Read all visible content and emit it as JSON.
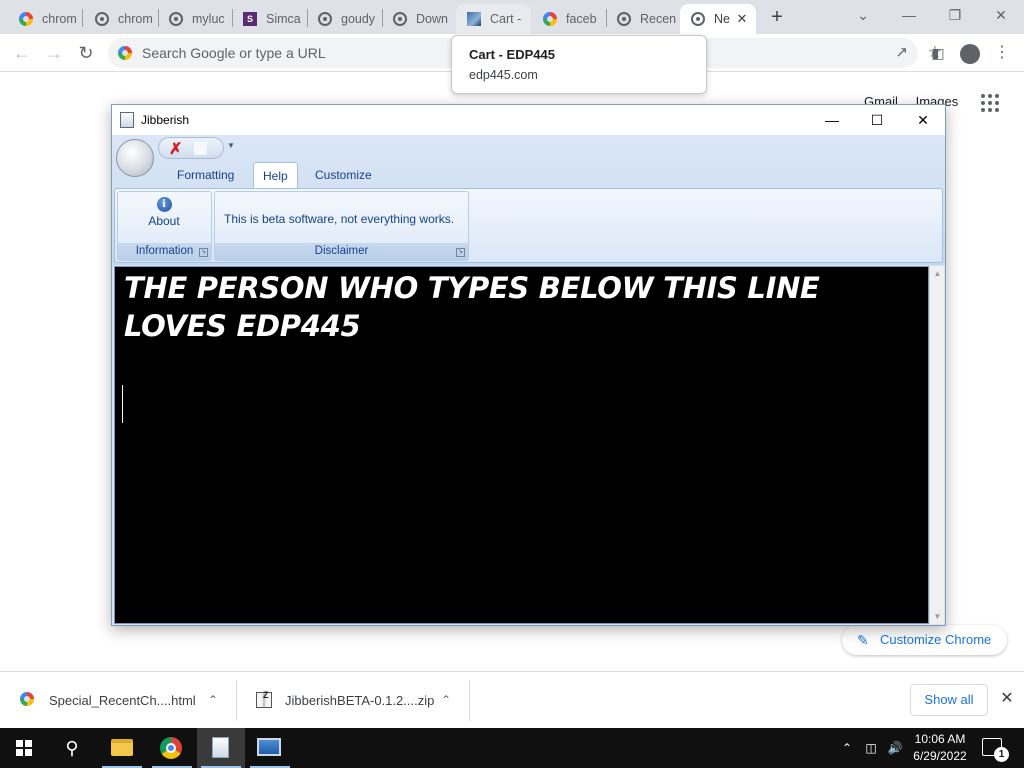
{
  "browser": {
    "tabs": [
      {
        "label": "chrom",
        "icon": "google-icon"
      },
      {
        "label": "chrom",
        "icon": "globe-icon"
      },
      {
        "label": "myluc",
        "icon": "globe-icon"
      },
      {
        "label": "Simca",
        "icon": "simca-icon"
      },
      {
        "label": "goudy",
        "icon": "globe-icon"
      },
      {
        "label": "Down",
        "icon": "globe-icon"
      },
      {
        "label": "Cart -",
        "icon": "cart-site-icon"
      },
      {
        "label": "faceb",
        "icon": "google-icon"
      },
      {
        "label": "Recen",
        "icon": "globe-icon"
      },
      {
        "label": "Ne",
        "icon": "chrome-icon",
        "active": true
      }
    ],
    "new_tab_symbol": "+",
    "tab_close_symbol": "✕",
    "window_controls": {
      "minimize": "—",
      "restore": "❐",
      "close": "✕",
      "tabsearch": "⌄"
    },
    "omnibox_placeholder": "Search Google or type a URL",
    "tooltip": {
      "title": "Cart - EDP445",
      "url": "edp445.com"
    },
    "ntp_links": [
      "Gmail",
      "Images"
    ],
    "customize_label": "Customize Chrome"
  },
  "app": {
    "title": "Jibberish",
    "window_controls": {
      "minimize": "—",
      "maximize": "☐",
      "close": "✕"
    },
    "ribbon_tabs": [
      {
        "label": "Formatting",
        "selected": false
      },
      {
        "label": "Help",
        "selected": true
      },
      {
        "label": "Customize",
        "selected": false
      }
    ],
    "groups": {
      "information": {
        "label": "Information",
        "about_button": "About"
      },
      "disclaimer": {
        "label": "Disclaimer",
        "text": "This is beta software, not everything works."
      }
    },
    "editor_text": "THE PERSON WHO TYPES BELOW THIS LINE LOVES EDP445"
  },
  "downloads": {
    "items": [
      {
        "name": "Special_RecentCh....html",
        "icon": "chrome-file-icon"
      },
      {
        "name": "JibberishBETA-0.1.2....zip",
        "icon": "zip-file-icon"
      }
    ],
    "show_all": "Show all",
    "close_symbol": "✕"
  },
  "taskbar": {
    "time": "10:06 AM",
    "date": "6/29/2022",
    "notification_count": "1"
  },
  "colors": {
    "accent": "#1a73e8",
    "ribbon_text": "#15428b",
    "editor_bg": "#000000",
    "editor_text": "#ffffff",
    "taskbar": "#101010"
  }
}
